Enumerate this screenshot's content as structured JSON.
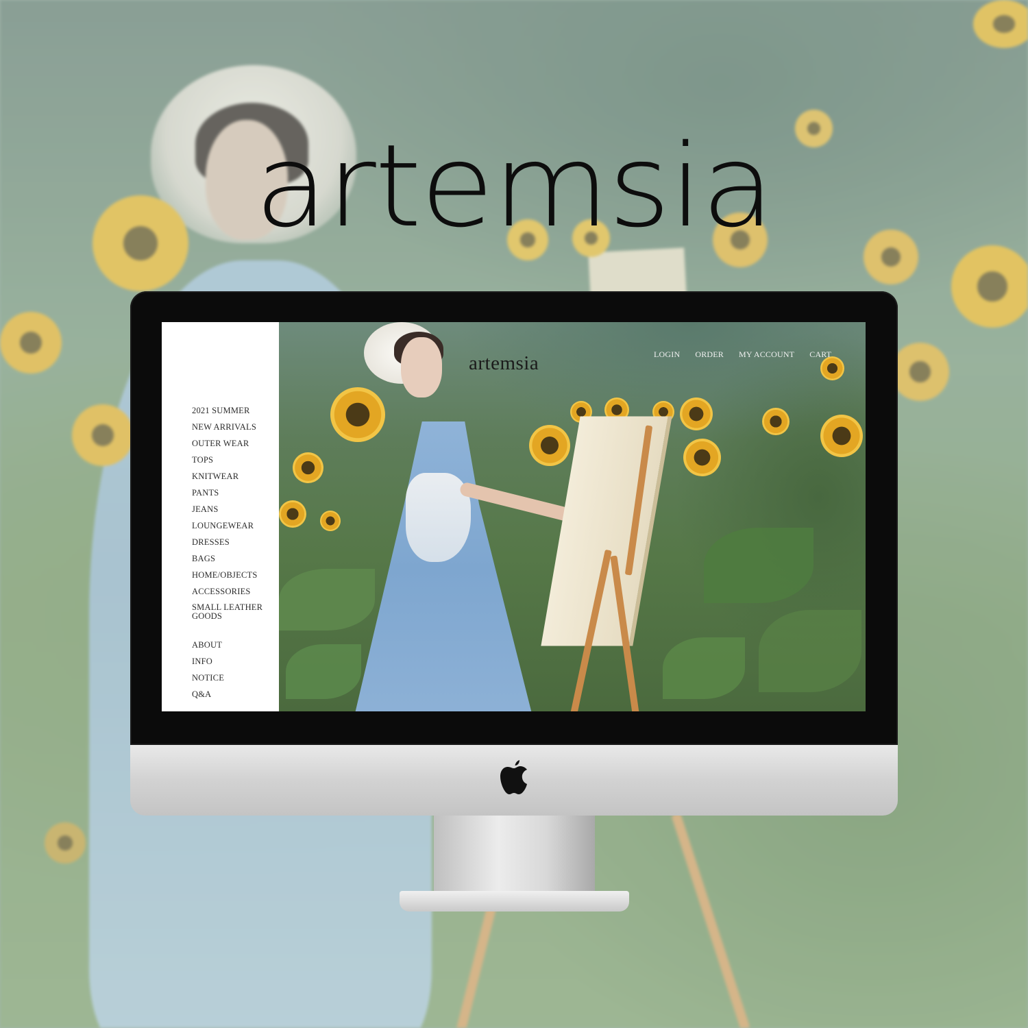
{
  "page": {
    "hero_logo": "artemsia"
  },
  "site": {
    "logo": "artemsia",
    "top_menu": [
      "LOGIN",
      "ORDER",
      "MY ACCOUNT",
      "CART"
    ],
    "categories": [
      "2021 SUMMER",
      "NEW ARRIVALS",
      "OUTER WEAR",
      "TOPS",
      "KNITWEAR",
      "PANTS",
      "JEANS",
      "LOUNGEWEAR",
      "DRESSES",
      "BAGS",
      "HOME/OBJECTS",
      "ACCESSORIES",
      "SMALL LEATHER GOODS"
    ],
    "info_links": [
      "ABOUT",
      "INFO",
      "NOTICE",
      "Q&A"
    ]
  },
  "device": {
    "logo_icon": "apple-logo-icon"
  },
  "colors": {
    "sidebar_bg": "#ffffff",
    "nav_text": "#2b2b2b",
    "bezel": "#0b0b0b",
    "dress_blue": "#8fb3d8",
    "sunflower_yellow": "#f2c546"
  }
}
